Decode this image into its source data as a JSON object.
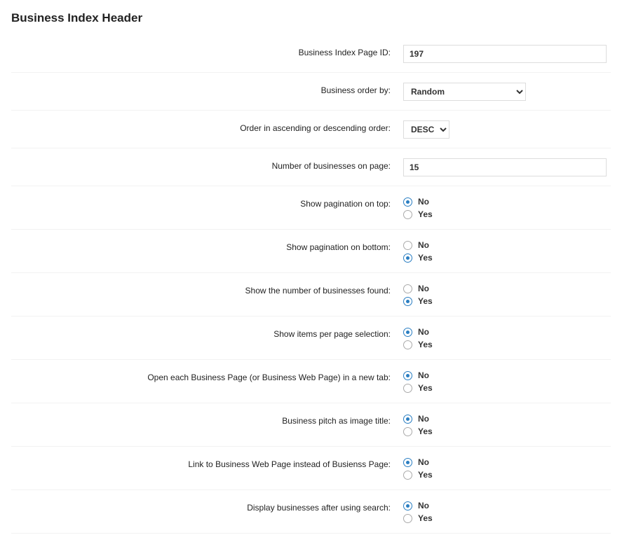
{
  "section_title": "Business Index Header",
  "options": {
    "no": "No",
    "yes": "Yes"
  },
  "rows": {
    "page_id": {
      "label": "Business Index Page ID:",
      "value": "197"
    },
    "order_by": {
      "label": "Business order by:",
      "value": "Random"
    },
    "order_dir": {
      "label": "Order in ascending or descending order:",
      "value": "DESC"
    },
    "per_page": {
      "label": "Number of businesses on page:",
      "value": "15"
    },
    "pag_top": {
      "label": "Show pagination on top:",
      "selected": "no"
    },
    "pag_bottom": {
      "label": "Show pagination on bottom:",
      "selected": "yes"
    },
    "show_count": {
      "label": "Show the number of businesses found:",
      "selected": "yes"
    },
    "show_ipp": {
      "label": "Show items per page selection:",
      "selected": "no"
    },
    "open_new_tab": {
      "label": "Open each Business Page (or Business Web Page) in a new tab:",
      "selected": "no"
    },
    "pitch_title": {
      "label": "Business pitch as image title:",
      "selected": "no"
    },
    "link_webpage": {
      "label": "Link to Business Web Page instead of Busienss Page:",
      "selected": "no"
    },
    "after_search": {
      "label": "Display businesses after using search:",
      "selected": "no"
    }
  }
}
